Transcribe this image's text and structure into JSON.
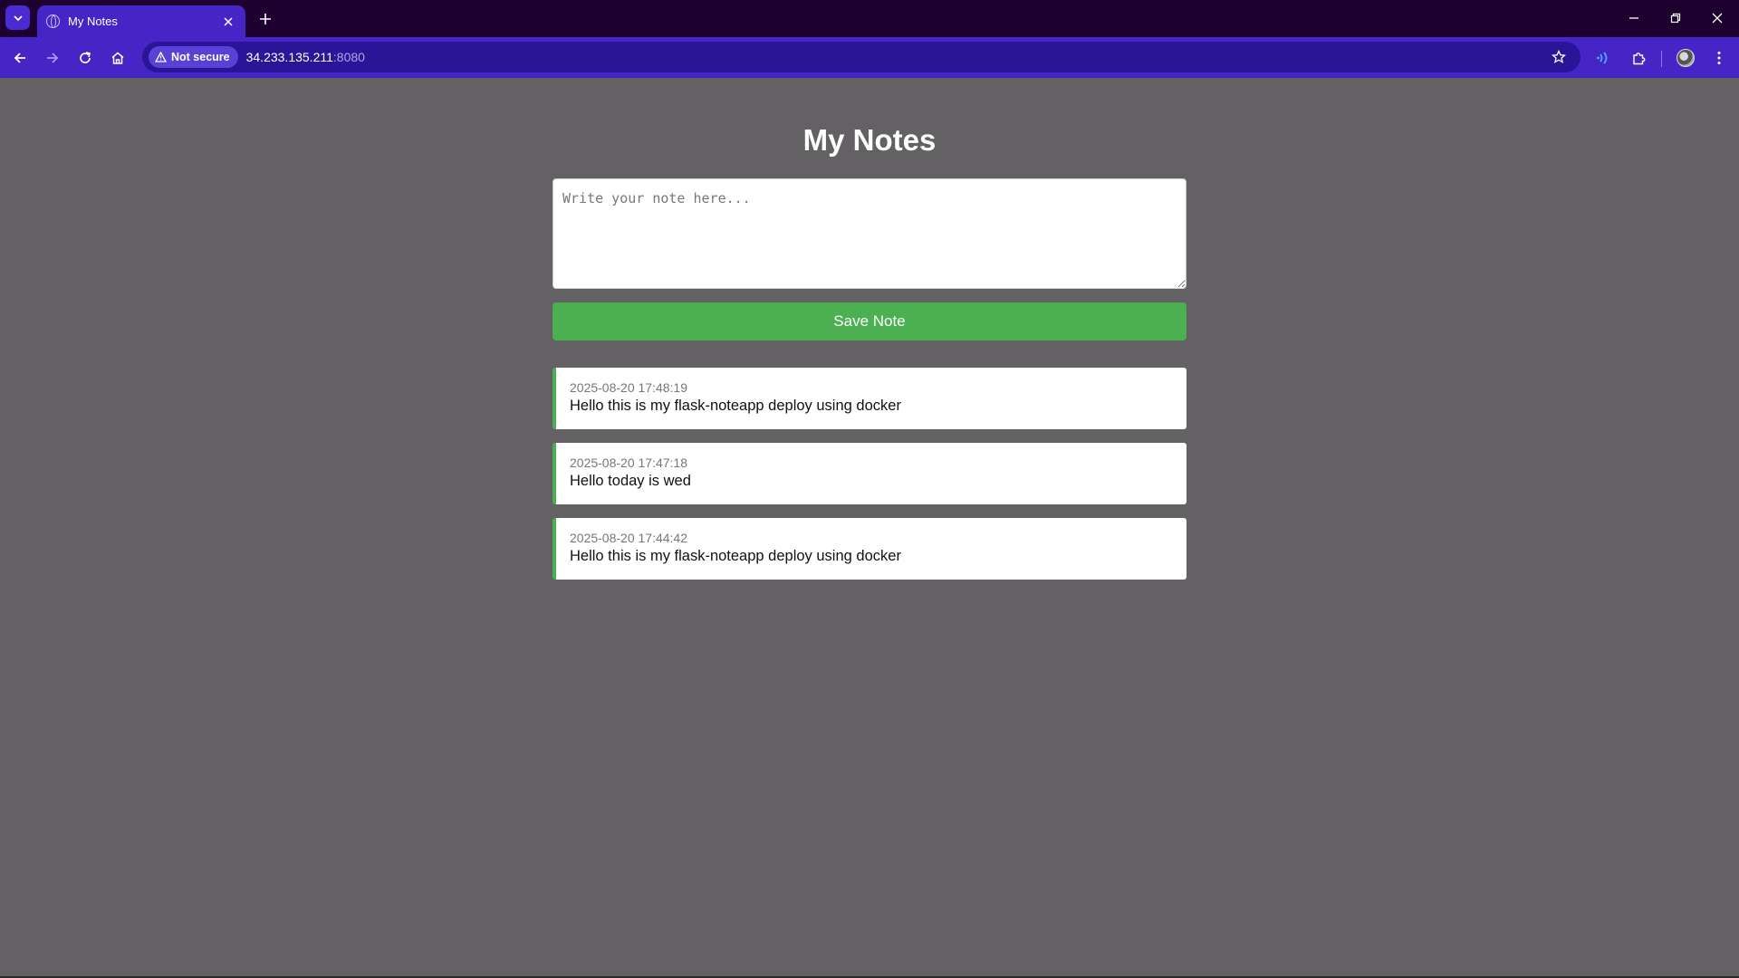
{
  "browser": {
    "tab": {
      "title": "My Notes"
    },
    "address": {
      "security_label": "Not secure",
      "host": "34.233.135.211",
      "port": ":8080"
    },
    "icons": {
      "tab_search": "chevron-down-icon",
      "favicon": "globe-icon",
      "close_tab": "close-icon",
      "new_tab": "plus-icon",
      "minimize": "minimize-icon",
      "restore": "restore-icon",
      "close_window": "close-icon",
      "back": "arrow-left-icon",
      "forward": "arrow-right-icon",
      "reload": "reload-icon",
      "home": "home-icon",
      "warning": "warning-icon",
      "bookmark": "star-icon",
      "media": "wifi-icon",
      "extensions": "puzzle-icon",
      "profile": "avatar-icon",
      "menu": "kebab-menu-icon"
    },
    "colors": {
      "frame": "#1e0030",
      "toolbar": "#4525c6",
      "omnibox": "#2a1497"
    }
  },
  "app": {
    "title": "My Notes",
    "input": {
      "placeholder": "Write your note here...",
      "value": ""
    },
    "save_label": "Save Note",
    "notes": [
      {
        "timestamp": "2025-08-20 17:48:19",
        "text": "Hello this is my flask-noteapp deploy using docker"
      },
      {
        "timestamp": "2025-08-20 17:47:18",
        "text": "Hello today is wed"
      },
      {
        "timestamp": "2025-08-20 17:44:42",
        "text": "Hello this is my flask-noteapp deploy using docker"
      }
    ],
    "colors": {
      "background": "#636163",
      "accent": "#4caf50",
      "card": "#ffffff"
    }
  }
}
